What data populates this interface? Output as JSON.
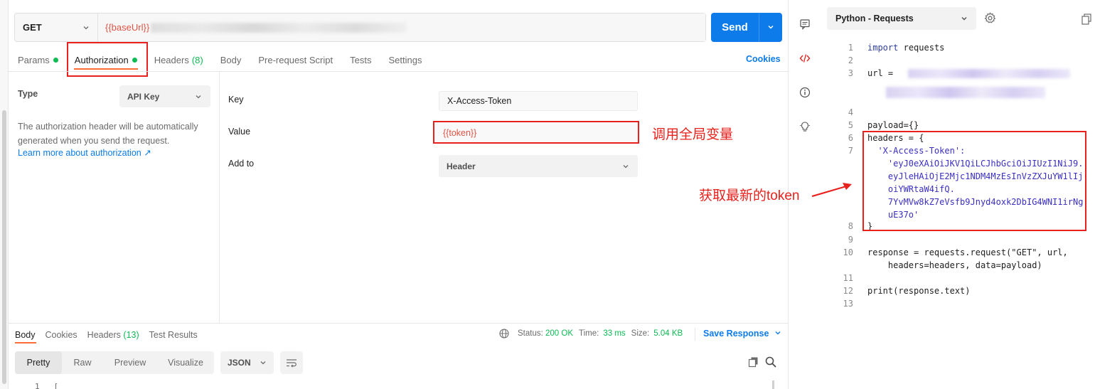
{
  "request": {
    "method": "GET",
    "url_prefix": "{{baseUrl}}",
    "send_label": "Send"
  },
  "tabs": [
    {
      "label": "Params",
      "count": "",
      "dot": true
    },
    {
      "label": "Authorization",
      "count": "",
      "dot": true
    },
    {
      "label": "Headers",
      "count": "(8)",
      "dot": false
    },
    {
      "label": "Body",
      "count": "",
      "dot": false
    },
    {
      "label": "Pre-request Script",
      "count": "",
      "dot": false
    },
    {
      "label": "Tests",
      "count": "",
      "dot": false
    },
    {
      "label": "Settings",
      "count": "",
      "dot": false
    }
  ],
  "cookies_label": "Cookies",
  "auth": {
    "type_label": "Type",
    "type_value": "API Key",
    "description": "The authorization header will be automatically generated when you send the request.",
    "learn_more": "Learn more about authorization ↗",
    "key_label": "Key",
    "key_value": "X-Access-Token",
    "value_label": "Value",
    "value_value": "{{token}}",
    "add_to_label": "Add to",
    "add_to_value": "Header"
  },
  "annotations": {
    "global_var": "调用全局变量",
    "latest_token": "获取最新的token"
  },
  "response": {
    "tabs": [
      {
        "label": "Body",
        "count": ""
      },
      {
        "label": "Cookies",
        "count": ""
      },
      {
        "label": "Headers",
        "count": "(13)"
      },
      {
        "label": "Test Results",
        "count": ""
      }
    ],
    "status_label": "Status:",
    "status_value": "200 OK",
    "time_label": "Time:",
    "time_value": "33 ms",
    "size_label": "Size:",
    "size_value": "5.04 KB",
    "save_label": "Save Response",
    "views": [
      "Pretty",
      "Raw",
      "Preview",
      "Visualize"
    ],
    "format": "JSON",
    "first_line_no": "1",
    "first_line_text": "["
  },
  "code_panel": {
    "language": "Python - Requests",
    "lines": [
      {
        "n": "1",
        "text": "import requests"
      },
      {
        "n": "2",
        "text": ""
      },
      {
        "n": "3",
        "text": "url = "
      },
      {
        "n": "4",
        "text": ""
      },
      {
        "n": "5",
        "text": "payload={}"
      },
      {
        "n": "6",
        "text": "headers = {"
      },
      {
        "n": "7",
        "text": "  'X-Access-Token':"
      },
      {
        "n": "",
        "text": "    'eyJ0eXAiOiJKV1QiLCJhbGciOiJIUzI1NiJ9."
      },
      {
        "n": "",
        "text": "    eyJleHAiOjE2Mjc1NDM4MzEsInVzZXJuYW1lIj"
      },
      {
        "n": "",
        "text": "    oiYWRtaW4ifQ."
      },
      {
        "n": "",
        "text": "    7YvMVw8kZ7eVsfb9Jnyd4oxk2DbIG4WNI1irNg"
      },
      {
        "n": "",
        "text": "    uE37o'"
      },
      {
        "n": "8",
        "text": "}"
      },
      {
        "n": "9",
        "text": ""
      },
      {
        "n": "10",
        "text": "response = requests.request(\"GET\", url,"
      },
      {
        "n": "",
        "text": "    headers=headers, data=payload)"
      },
      {
        "n": "11",
        "text": ""
      },
      {
        "n": "12",
        "text": "print(response.text)"
      },
      {
        "n": "13",
        "text": ""
      }
    ]
  },
  "colors": {
    "accent_orange": "#ff6c37",
    "link_blue": "#0d7bea",
    "send_blue": "#0d7bea",
    "success_green": "#0cbb52",
    "annotation_red": "#e8211c",
    "variable_red": "#e05243"
  },
  "icons": [
    "chevron-down-icon",
    "comment-icon",
    "code-icon",
    "info-icon",
    "lightbulb-icon",
    "gear-icon",
    "copy-icon",
    "globe-icon",
    "search-icon",
    "wrap-icon"
  ]
}
